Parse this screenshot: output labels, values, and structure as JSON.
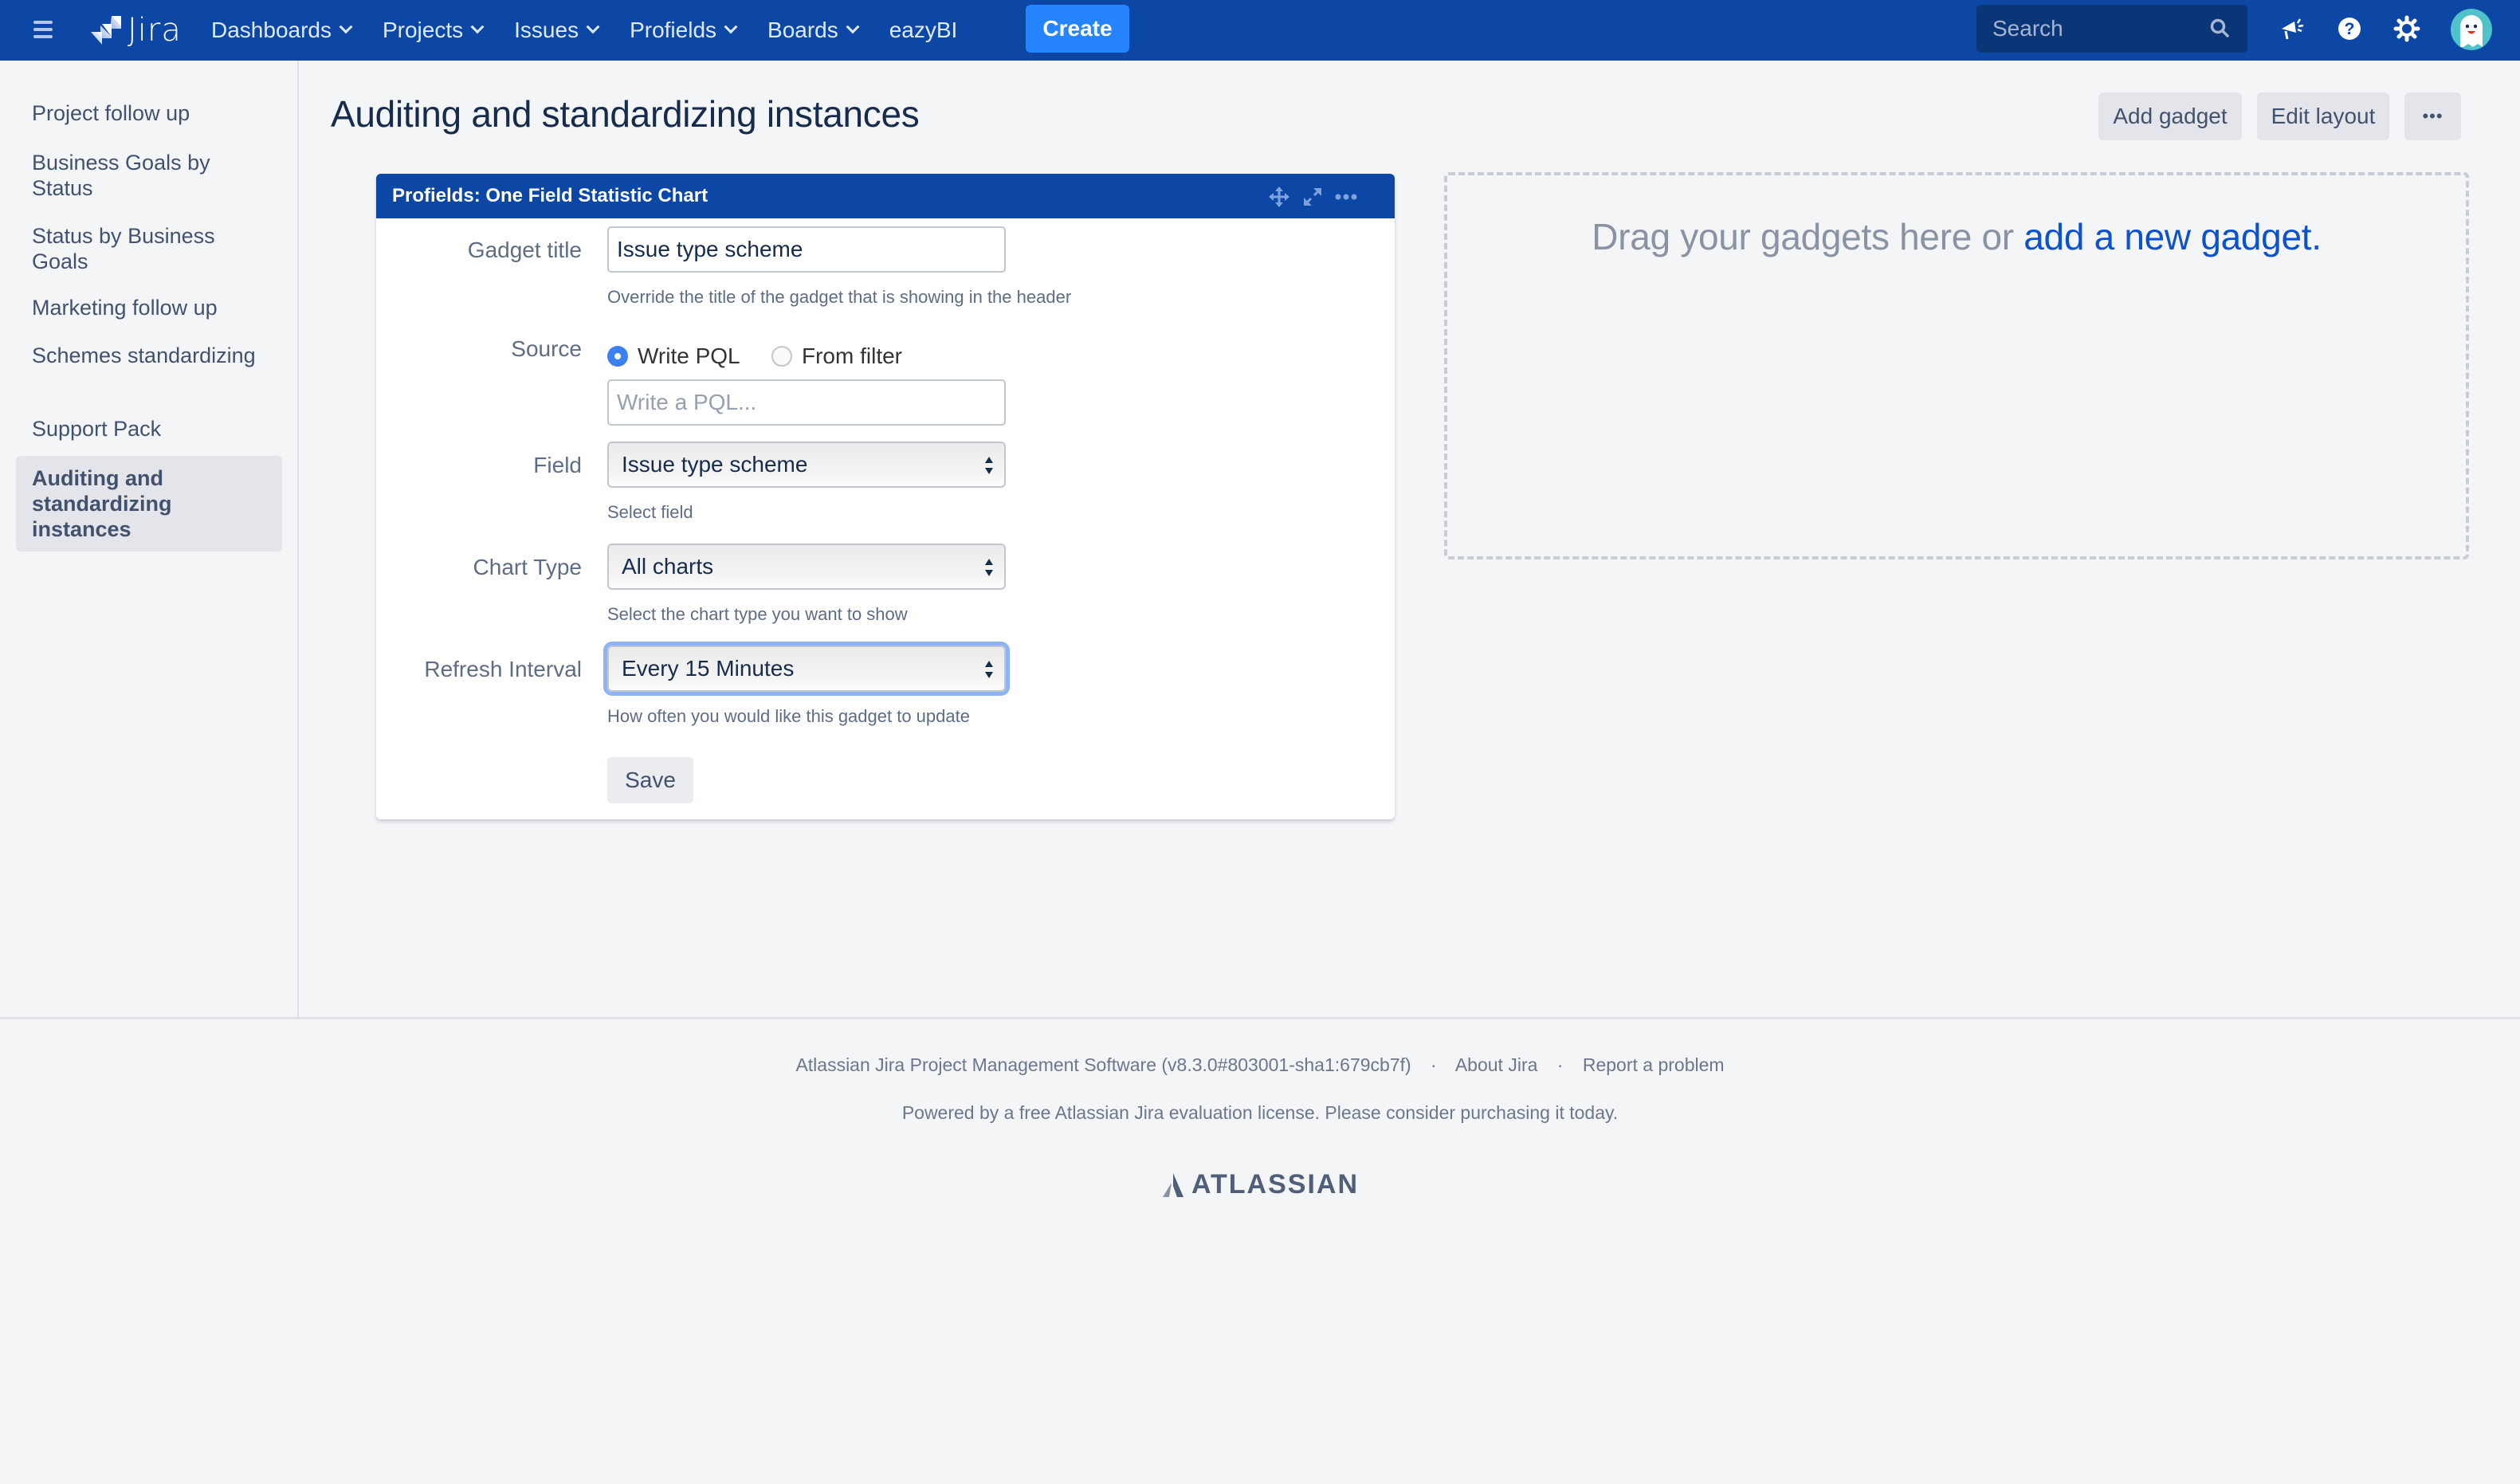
{
  "topnav": {
    "app_name": "Jira",
    "items": [
      {
        "label": "Dashboards",
        "dropdown": true
      },
      {
        "label": "Projects",
        "dropdown": true
      },
      {
        "label": "Issues",
        "dropdown": true
      },
      {
        "label": "Profields",
        "dropdown": true
      },
      {
        "label": "Boards",
        "dropdown": true
      },
      {
        "label": "eazyBI",
        "dropdown": false
      }
    ],
    "create_label": "Create",
    "search_placeholder": "Search",
    "icons": [
      "menu-icon",
      "jira-logo",
      "search-icon",
      "megaphone-icon",
      "help-icon",
      "settings-icon",
      "avatar"
    ],
    "brand_color": "#0c47a6",
    "create_color": "#2684ff"
  },
  "sidebar": {
    "items": [
      {
        "label": "Project follow up",
        "active": false
      },
      {
        "label": "Business Goals by Status",
        "active": false
      },
      {
        "label": "Status by Business Goals",
        "active": false
      },
      {
        "label": "Marketing follow up",
        "active": false
      },
      {
        "label": "Schemes standardizing",
        "active": false
      },
      {
        "label": "Support Pack",
        "active": false
      },
      {
        "label": "Auditing and standardizing instances",
        "active": true
      }
    ]
  },
  "page": {
    "title": "Auditing and standardizing instances",
    "add_gadget_label": "Add gadget",
    "edit_layout_label": "Edit layout",
    "more_label": "•••"
  },
  "gadget": {
    "header_title": "Profields: One Field Statistic Chart",
    "fields": {
      "gadget_title": {
        "label": "Gadget title",
        "value": "Issue type scheme",
        "help": "Override the title of the gadget that is showing in the header"
      },
      "source": {
        "label": "Source",
        "options": [
          {
            "label": "Write PQL",
            "checked": true
          },
          {
            "label": "From filter",
            "checked": false
          }
        ],
        "pql_placeholder": "Write a PQL..."
      },
      "field": {
        "label": "Field",
        "value": "Issue type scheme",
        "help": "Select field"
      },
      "chart_type": {
        "label": "Chart Type",
        "value": "All charts",
        "help": "Select the chart type you want to show"
      },
      "refresh_interval": {
        "label": "Refresh Interval",
        "value": "Every 15 Minutes",
        "help": "How often you would like this gadget to update"
      }
    },
    "save_label": "Save"
  },
  "dropzone": {
    "text": "Drag your gadgets here or ",
    "link": "add a new gadget."
  },
  "footer": {
    "version_text": "Atlassian Jira Project Management Software (v8.3.0#803001-sha1:679cb7f)",
    "separator": "·",
    "about_label": "About Jira",
    "report_label": "Report a problem",
    "license_text": "Powered by a free Atlassian Jira evaluation license. Please consider purchasing it today.",
    "brand": "ATLASSIAN"
  }
}
